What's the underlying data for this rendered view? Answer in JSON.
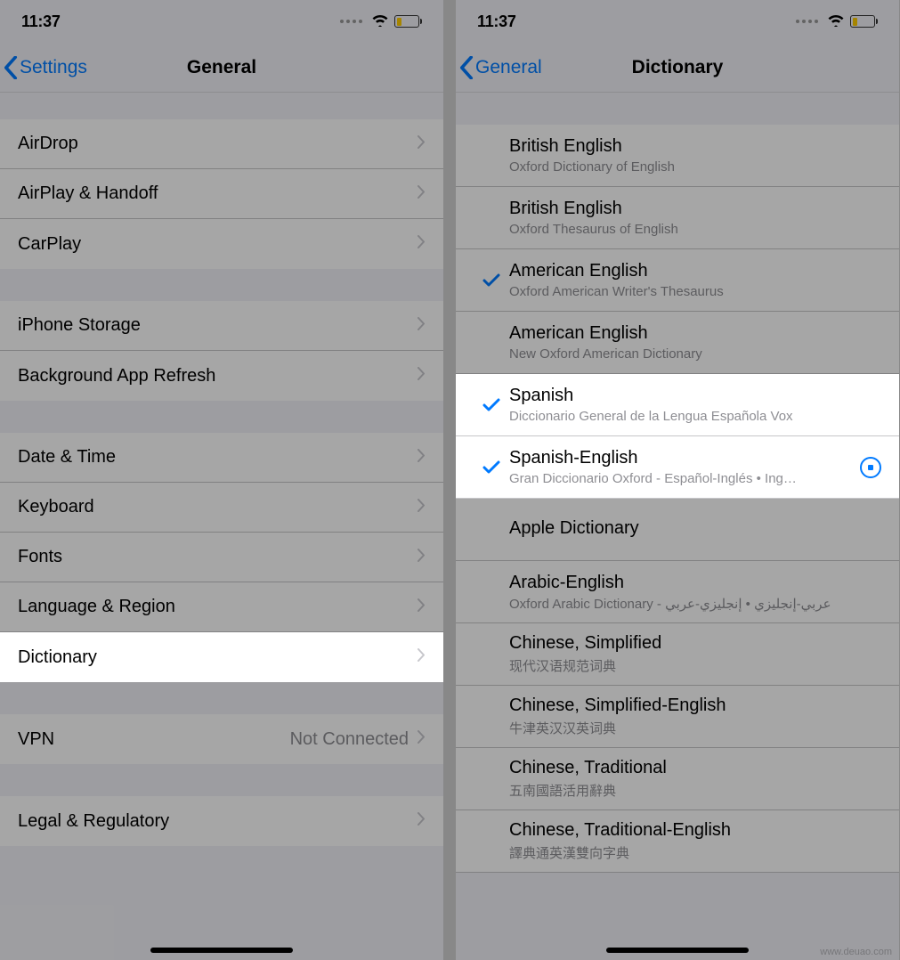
{
  "watermark": "www.deuao.com",
  "left": {
    "status": {
      "time": "11:37"
    },
    "nav": {
      "back": "Settings",
      "title": "General"
    },
    "groups": [
      [
        {
          "label": "AirDrop"
        },
        {
          "label": "AirPlay & Handoff"
        },
        {
          "label": "CarPlay"
        }
      ],
      [
        {
          "label": "iPhone Storage"
        },
        {
          "label": "Background App Refresh"
        }
      ],
      [
        {
          "label": "Date & Time"
        },
        {
          "label": "Keyboard"
        },
        {
          "label": "Fonts"
        },
        {
          "label": "Language & Region"
        },
        {
          "label": "Dictionary",
          "highlight": true
        }
      ],
      [
        {
          "label": "VPN",
          "detail": "Not Connected"
        }
      ],
      [
        {
          "label": "Legal & Regulatory"
        }
      ]
    ]
  },
  "right": {
    "status": {
      "time": "11:37"
    },
    "nav": {
      "back": "General",
      "title": "Dictionary"
    },
    "items": [
      {
        "title": "British English",
        "sub": "Oxford Dictionary of English",
        "checked": false
      },
      {
        "title": "British English",
        "sub": "Oxford Thesaurus of English",
        "checked": false
      },
      {
        "title": "American English",
        "sub": "Oxford American Writer's Thesaurus",
        "checked": true
      },
      {
        "title": "American English",
        "sub": "New Oxford American Dictionary",
        "checked": false
      },
      {
        "title": "Spanish",
        "sub": "Diccionario General de la Lengua Española Vox",
        "checked": true,
        "highlight": true
      },
      {
        "title": "Spanish-English",
        "sub": "Gran Diccionario Oxford - Español-Inglés • Ing…",
        "checked": true,
        "highlight": true,
        "loading": true
      },
      {
        "title": "Apple Dictionary",
        "sub": "",
        "checked": false
      },
      {
        "title": "Arabic-English",
        "sub": "Oxford Arabic Dictionary - عربي-إنجليزي • إنجليزي-عربي",
        "checked": false
      },
      {
        "title": "Chinese, Simplified",
        "sub": "现代汉语规范词典",
        "checked": false
      },
      {
        "title": "Chinese, Simplified-English",
        "sub": "牛津英汉汉英词典",
        "checked": false
      },
      {
        "title": "Chinese, Traditional",
        "sub": "五南國語活用辭典",
        "checked": false
      },
      {
        "title": "Chinese, Traditional-English",
        "sub": "譯典通英漢雙向字典",
        "checked": false
      }
    ]
  }
}
